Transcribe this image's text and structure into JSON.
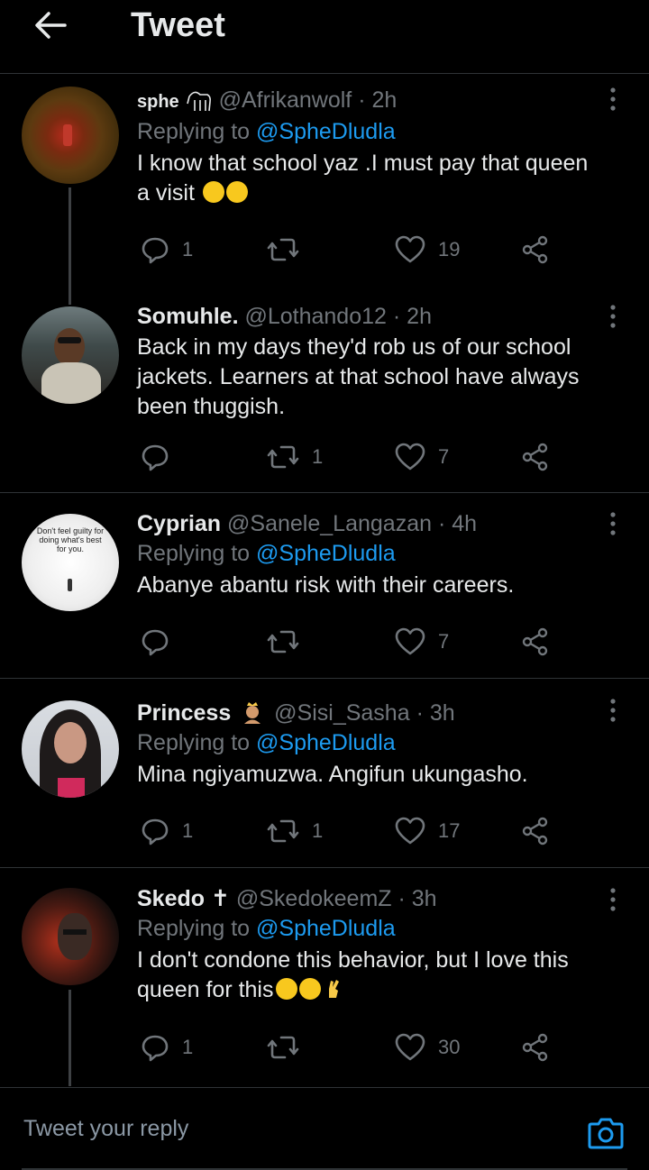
{
  "header": {
    "title": "Tweet"
  },
  "tweets": [
    {
      "name": "sphe",
      "handle": "@Afrikanwolf",
      "time": "· 2h",
      "replying_prefix": "Replying to",
      "replying_to": "@SpheDludla",
      "text": "I know that school yaz .I must pay that queen a visit",
      "counts": {
        "replies": "1",
        "retweets": "",
        "likes": "19"
      }
    },
    {
      "name": "Somuhle.",
      "handle": "@Lothando12",
      "time": "· 2h",
      "text": "Back in my days they'd rob us of our school jackets. Learners at that school have always been thuggish.",
      "counts": {
        "replies": "",
        "retweets": "1",
        "likes": "7"
      }
    },
    {
      "name": "Cyprian",
      "handle": "@Sanele_Langazan",
      "time": "· 4h",
      "replying_prefix": "Replying to",
      "replying_to": "@SpheDludla",
      "text": "Abanye abantu risk with their careers.",
      "avatar_text": "Don't feel guilty for doing what's best for you.",
      "counts": {
        "replies": "",
        "retweets": "",
        "likes": "7"
      }
    },
    {
      "name": "Princess",
      "handle": "@Sisi_Sasha",
      "time": "· 3h",
      "replying_prefix": "Replying to",
      "replying_to": "@SpheDludla",
      "text": "Mina ngiyamuzwa. Angifun ukungasho.",
      "counts": {
        "replies": "1",
        "retweets": "1",
        "likes": "17"
      }
    },
    {
      "name": "Skedo ✝",
      "handle": "@SkedokeemZ",
      "time": "· 3h",
      "replying_prefix": "Replying to",
      "replying_to": "@SpheDludla",
      "text": "I don't condone this behavior, but I love this queen for this",
      "counts": {
        "replies": "1",
        "retweets": "",
        "likes": "30"
      }
    }
  ],
  "compose": {
    "placeholder": "Tweet your reply"
  },
  "colors": {
    "background": "#000000",
    "link": "#1d9bf0",
    "muted": "#71767b",
    "divider": "#2f3336"
  }
}
